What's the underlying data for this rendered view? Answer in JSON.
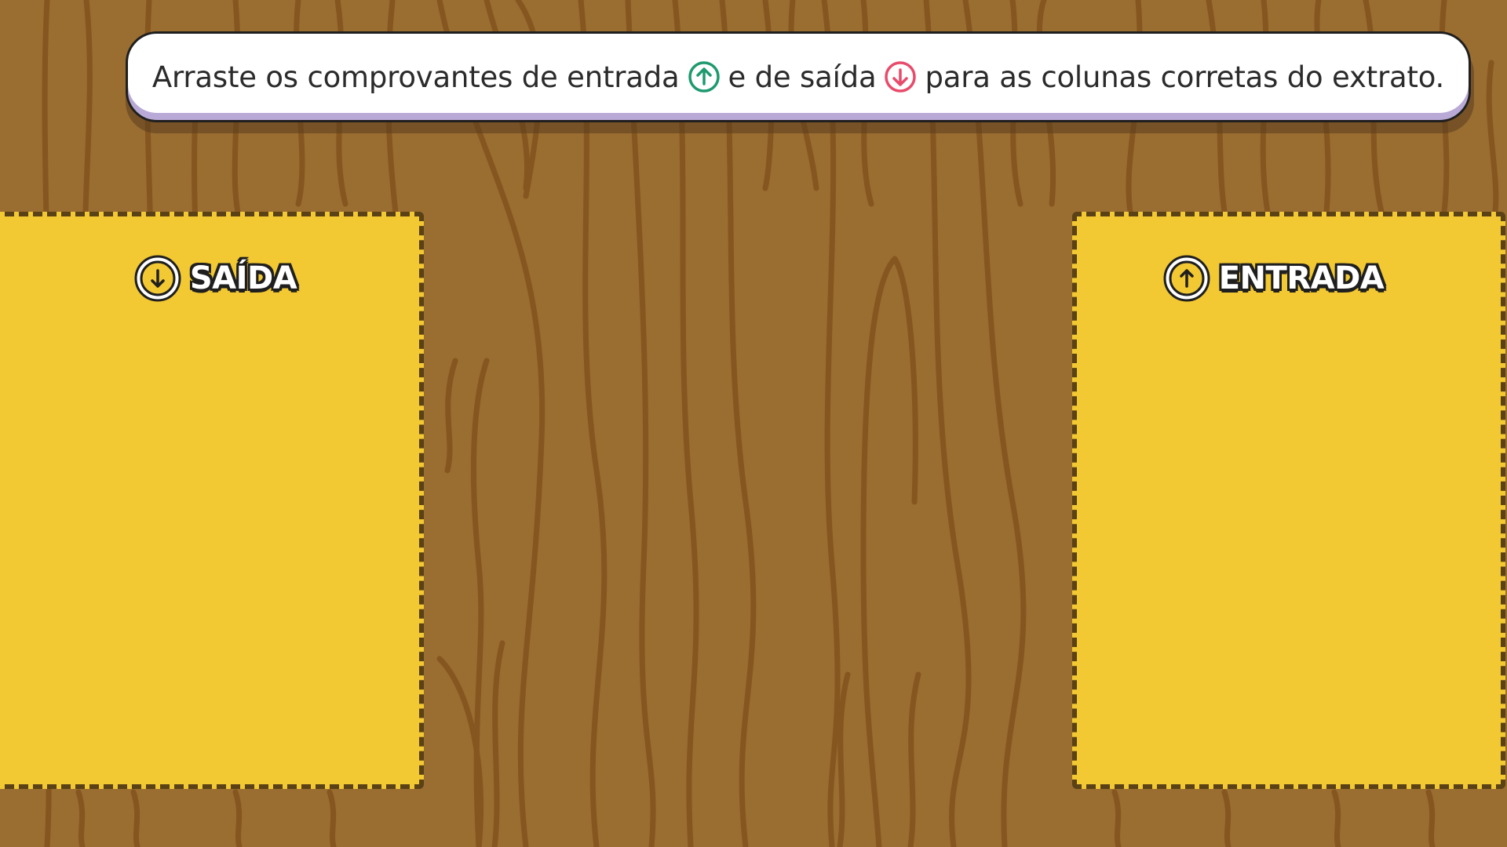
{
  "instruction": {
    "part1": "Arraste os comprovantes de entrada",
    "part2": "e de saída",
    "part3": "para as colunas corretas do extrato.",
    "icon_in": "arrow-up-circle-icon",
    "icon_out": "arrow-down-circle-icon",
    "color_in": "#1e9a6e",
    "color_out": "#e84b6b"
  },
  "columns": {
    "saida": {
      "label": "SAÍDA",
      "icon": "arrow-down-circle-icon"
    },
    "entrada": {
      "label": "ENTRADA",
      "icon": "arrow-up-circle-icon"
    }
  },
  "colors": {
    "background_wood": "#9a6d31",
    "wood_grain": "#85561f",
    "drop_zone": "#f2c833",
    "drop_zone_border": "#5a4116",
    "banner_accent": "#b9a9d6"
  }
}
